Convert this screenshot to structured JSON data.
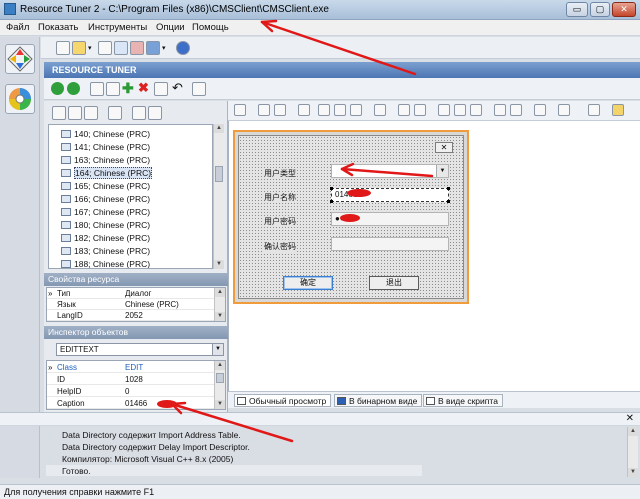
{
  "window": {
    "title": "Resource Tuner 2 - C:\\Program Files (x86)\\CMSClient\\CMSClient.exe",
    "minimize_glyph": "▭",
    "maximize_glyph": "▢",
    "close_glyph": "✕"
  },
  "menu": [
    "Файл",
    "Показать",
    "Инструменты",
    "Опции",
    "Помощь"
  ],
  "header": {
    "title": "RESOURCE TUNER"
  },
  "tree": {
    "items": [
      "140; Chinese (PRC)",
      "141; Chinese (PRC)",
      "163; Chinese (PRC)",
      "164; Chinese (PRC)",
      "165; Chinese (PRC)",
      "166; Chinese (PRC)",
      "167; Chinese (PRC)",
      "180; Chinese (PRC)",
      "182; Chinese (PRC)",
      "183; Chinese (PRC)",
      "188; Chinese (PRC)"
    ],
    "selected_index": 3
  },
  "resource_props": {
    "title": "Свойства ресурса",
    "rows": [
      {
        "key": "Тип",
        "value": "Диалог"
      },
      {
        "key": "Язык",
        "value": "Chinese (PRC)"
      },
      {
        "key": "LangID",
        "value": "2052"
      }
    ]
  },
  "inspector": {
    "title": "Инспектор объектов",
    "combo_value": "EDITTEXT",
    "rows": [
      {
        "key": "Class",
        "value": "EDIT"
      },
      {
        "key": "ID",
        "value": "1028"
      },
      {
        "key": "HelpID",
        "value": "0"
      },
      {
        "key": "Caption",
        "value": "01466"
      }
    ]
  },
  "dialog": {
    "close_glyph": "✕",
    "labels": [
      "用户类型",
      "用户名称",
      "用户密码",
      "确认密码"
    ],
    "username_value": "01466",
    "password_value": "●●",
    "ok_label": "确定",
    "exit_label": "退出"
  },
  "editor_tabs": [
    "Обычный просмотр",
    "В бинарном виде",
    "В виде скрипта"
  ],
  "output": {
    "lines": [
      "Data Directory содержит Import Address Table.",
      "Data Directory содержит Delay Import Descriptor.",
      "Компилятор: Microsoft Visual C++ 8.x (2005)",
      "Готово."
    ]
  },
  "statusbar": {
    "text": "Для получения справки нажмите F1"
  },
  "colors": {
    "annotation": "#e01818",
    "dialog_border": "#f09b3c",
    "header_blue": "#4b76b3"
  }
}
